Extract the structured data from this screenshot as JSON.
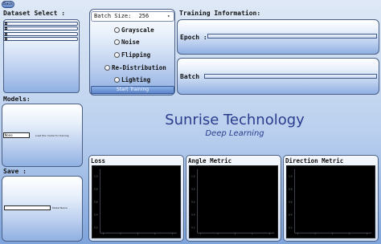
{
  "window": {
    "back_label": "Back"
  },
  "dataset": {
    "title": "Dataset Select :",
    "items": [
      {
        "label": "",
        "checked": false
      },
      {
        "label": "",
        "checked": false
      },
      {
        "label": "",
        "checked": false
      },
      {
        "label": "",
        "checked": false
      }
    ]
  },
  "models": {
    "title": "Models:",
    "value": "None",
    "hint": "Load this model for training"
  },
  "save": {
    "title": "Save :",
    "value": "",
    "hint": "Model Name"
  },
  "options": {
    "batch_label": "Batch Size:",
    "batch_value": "256",
    "augmentations": [
      "Grayscale",
      "Noise",
      "Flipping",
      "Re-Distribution",
      "Lighting"
    ],
    "start_label": "Start Training"
  },
  "training": {
    "title": "Training Information:",
    "epoch_label": "Epoch :",
    "batch_label": "Batch :",
    "epoch_progress": 0,
    "batch_progress": 0
  },
  "brand": {
    "title": "Sunrise Technology",
    "subtitle": "Deep Learning",
    "color": "#2a3c8c"
  },
  "charts": [
    {
      "title": "Loss"
    },
    {
      "title": "Angle Metric"
    },
    {
      "title": "Direction Metric"
    }
  ],
  "chart_data": [
    {
      "type": "line",
      "title": "Loss",
      "series": [],
      "ytick_labels": [
        "1.0",
        "0.8",
        "0.6",
        "0.4",
        "0.2"
      ]
    },
    {
      "type": "line",
      "title": "Angle Metric",
      "series": [],
      "ytick_labels": [
        "1.0",
        "0.8",
        "0.6",
        "0.4",
        "0.2"
      ]
    },
    {
      "type": "line",
      "title": "Direction Metric",
      "series": [],
      "ytick_labels": [
        "1.0",
        "0.8",
        "0.6",
        "0.4",
        "0.2"
      ]
    }
  ]
}
